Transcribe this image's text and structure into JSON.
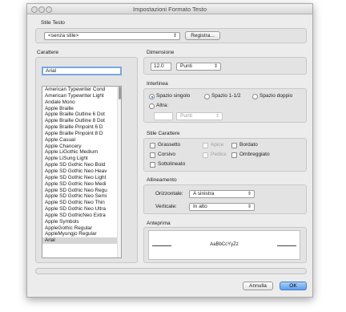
{
  "window": {
    "title": "Impostazioni Formato Testo"
  },
  "stile_testo": {
    "label": "Stile Testo",
    "selected": "<senza stile>",
    "register_button": "Registra..."
  },
  "carattere": {
    "label": "Carattere",
    "search_value": "Arial",
    "fonts": [
      "American Typewriter Cond",
      "American Typewriter Light",
      "Andale Mono",
      "Apple Braille",
      "Apple Braille Outline 6 Dot",
      "Apple Braille Outline 8 Dot",
      "Apple Braille Pinpoint 6 D",
      "Apple Braille Pinpoint 8 D",
      "Apple Casual",
      "Apple Chancery",
      "Apple LiGothic Medium",
      "Apple LiSung Light",
      "Apple SD Gothic Neo Bold",
      "Apple SD Gothic Neo Heav",
      "Apple SD Gothic Neo Light",
      "Apple SD Gothic Neo Medi",
      "Apple SD Gothic Neo Regu",
      "Apple SD Gothic Neo Semi",
      "Apple SD Gothic Neo Thin",
      "Apple SD Gothic Neo Ultra",
      "Apple SD GothicNeo Extra",
      "Apple Symbols",
      "AppleGothic Regular",
      "AppleMyungjo Regular",
      "Arial"
    ],
    "selected_font": "Arial"
  },
  "dimensione": {
    "label": "Dimensione",
    "value": "12.0",
    "unit": "Punti"
  },
  "interlinea": {
    "label": "Interlinea",
    "options": [
      "Spazio singolo",
      "Spazio 1-1/2",
      "Spazio doppio",
      "Altra:"
    ],
    "selected": "Spazio singolo",
    "other_unit": "Punti"
  },
  "stile_carattere": {
    "label": "Stile Carattere",
    "options": [
      "Grassetto",
      "Apice",
      "Bordato",
      "Corsivo",
      "Pedice",
      "Ombreggiato",
      "Sottolineato"
    ],
    "disabled": [
      "Apice",
      "Pedice"
    ]
  },
  "allineamento": {
    "label": "Allineamento",
    "horizontal_label": "Orizzontale:",
    "horizontal_value": "A sinistra",
    "vertical_label": "Verticale:",
    "vertical_value": "In alto"
  },
  "anteprima": {
    "label": "Anteprima",
    "sample": "AaBbCcYyZz"
  },
  "buttons": {
    "cancel": "Annulla",
    "ok": "OK"
  },
  "colors": {
    "accent": "#5e9ff0",
    "window_bg": "#ececec"
  }
}
